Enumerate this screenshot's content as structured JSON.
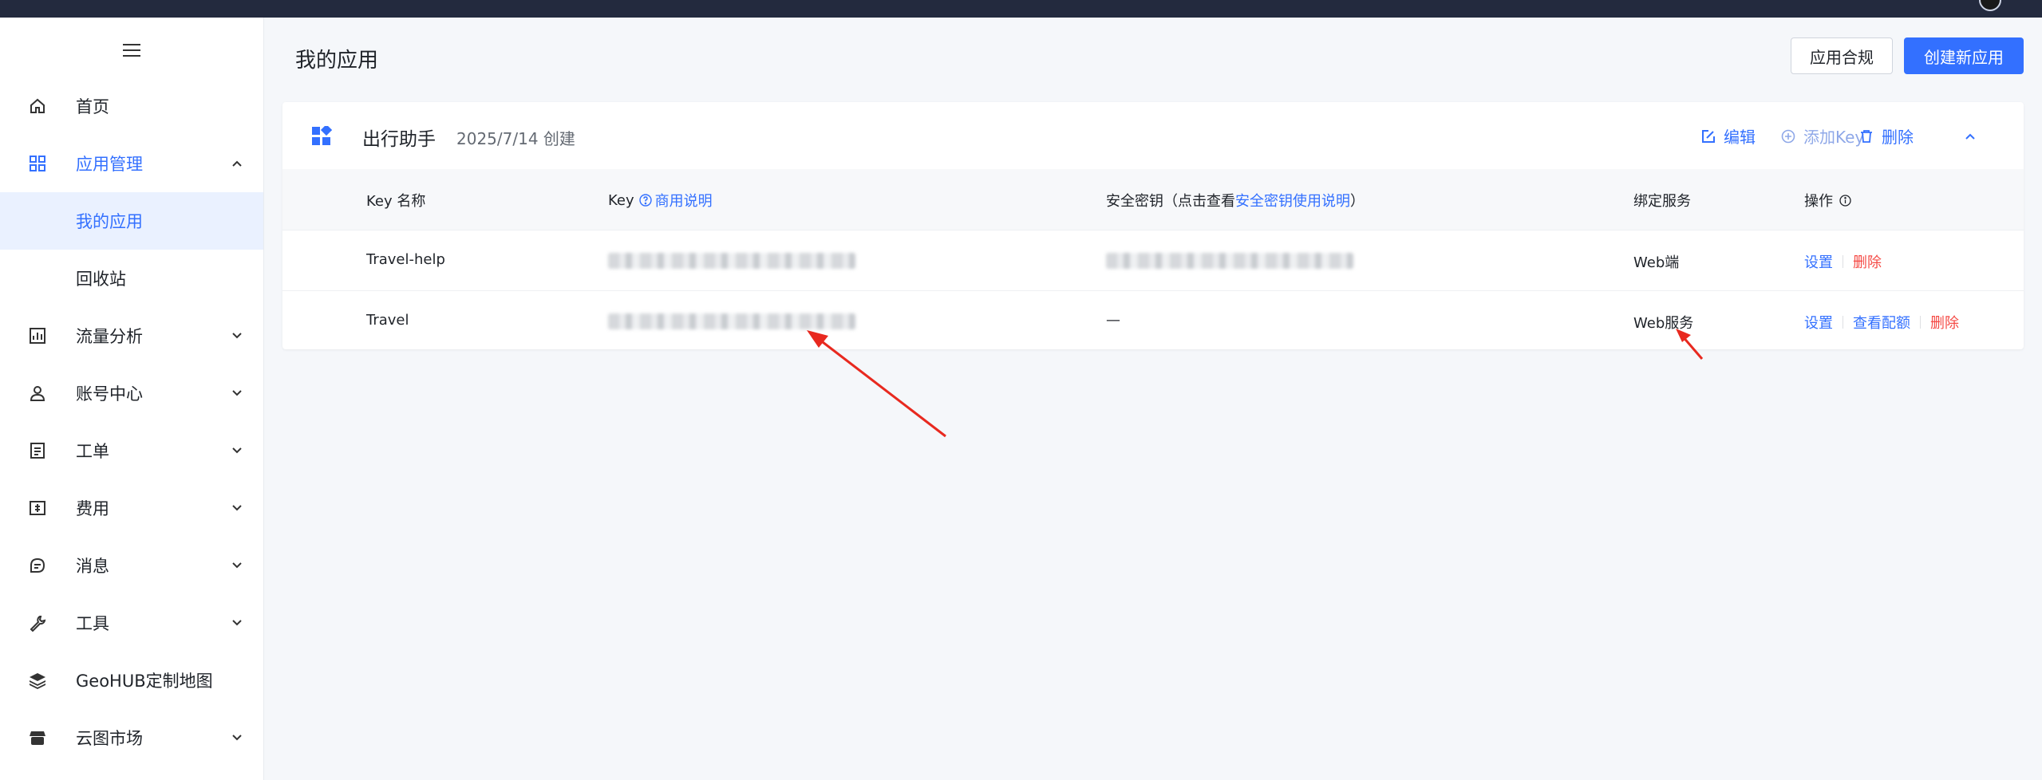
{
  "sidebar": {
    "items": [
      {
        "label": "首页",
        "icon": "home-icon"
      },
      {
        "label": "应用管理",
        "icon": "grid-icon"
      },
      {
        "label": "流量分析",
        "icon": "chart-icon"
      },
      {
        "label": "账号中心",
        "icon": "user-icon"
      },
      {
        "label": "工单",
        "icon": "ticket-icon"
      },
      {
        "label": "费用",
        "icon": "billing-icon"
      },
      {
        "label": "消息",
        "icon": "message-icon"
      },
      {
        "label": "工具",
        "icon": "wrench-icon"
      },
      {
        "label": "GeoHUB定制地图",
        "icon": "layers-icon"
      },
      {
        "label": "云图市场",
        "icon": "store-icon"
      }
    ],
    "subitems": [
      {
        "label": "我的应用"
      },
      {
        "label": "回收站"
      }
    ]
  },
  "header": {
    "title": "我的应用",
    "compliance_label": "应用合规",
    "create_label": "创建新应用"
  },
  "app": {
    "name": "出行助手",
    "created": "2025/7/14 创建",
    "edit_label": "编辑",
    "add_key_label": "添加Key",
    "delete_label": "删除"
  },
  "table": {
    "columns": {
      "key_name": "Key 名称",
      "key": "Key",
      "key_help": "商用说明",
      "secret_prefix": "安全密钥（点击查看",
      "secret_link": "安全密钥使用说明",
      "secret_suffix": "）",
      "service": "绑定服务",
      "ops": "操作"
    },
    "rows": [
      {
        "name": "Travel-help",
        "secret": "",
        "service": "Web端",
        "ops": [
          "设置",
          "删除"
        ]
      },
      {
        "name": "Travel",
        "secret": "—",
        "service": "Web服务",
        "ops": [
          "设置",
          "查看配额",
          "删除"
        ]
      }
    ]
  },
  "colors": {
    "accent": "#3370ff",
    "danger": "#f54a45",
    "topbar": "#232a3e",
    "annotation": "#e8291f"
  }
}
